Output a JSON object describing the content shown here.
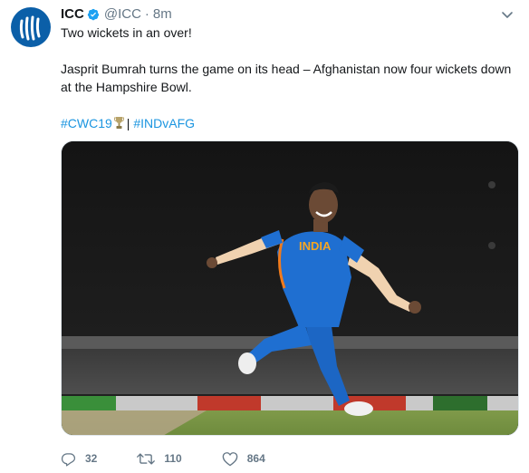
{
  "tweet": {
    "author_name": "ICC",
    "handle": "@ICC",
    "separator": "·",
    "time": "8m",
    "line1": "Two wickets in an over!",
    "line2": "Jasprit Bumrah turns the game on its head – Afghanistan now four wickets down at the Hampshire Bowl.",
    "hashtag1": "#CWC19",
    "pipe": "|",
    "hashtag2": "#INDvAFG",
    "jersey_text": "INDIA"
  },
  "actions": {
    "replies": "32",
    "retweets": "110",
    "likes": "864"
  },
  "colors": {
    "link": "#1b95e0",
    "muted": "#657786",
    "verified": "#1da1f2",
    "jersey": "#1f6fd1"
  }
}
